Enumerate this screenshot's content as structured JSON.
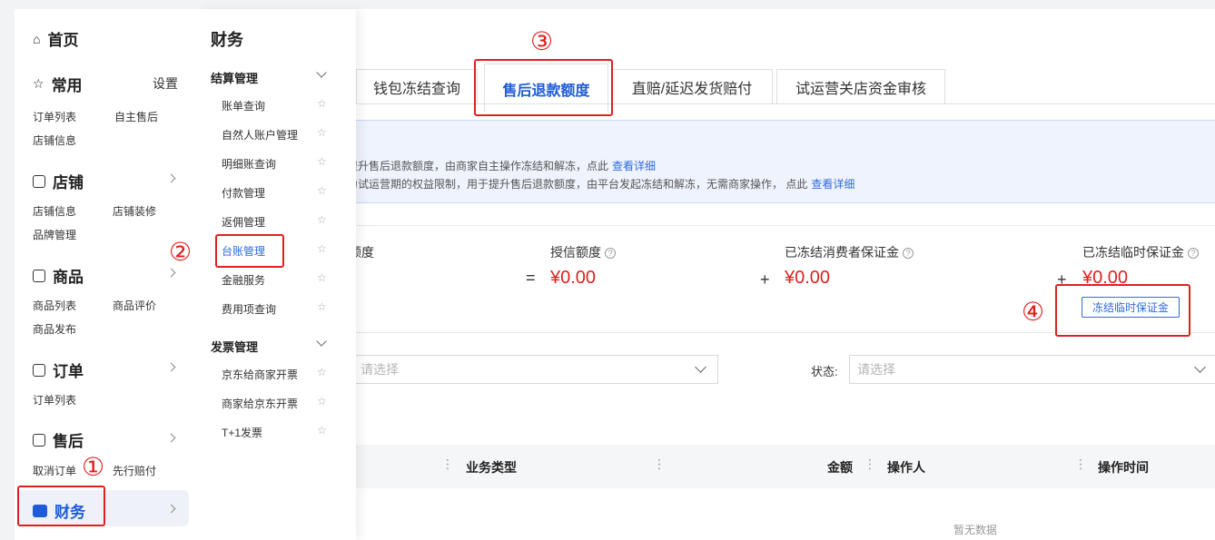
{
  "sidebar": {
    "home": "首页",
    "common": {
      "title": "常用",
      "settings": "设置",
      "links": [
        "订单列表",
        "自主售后",
        "店铺信息"
      ]
    },
    "store": {
      "title": "店铺",
      "links": [
        "店铺信息",
        "店铺装修",
        "品牌管理"
      ]
    },
    "goods": {
      "title": "商品",
      "links": [
        "商品列表",
        "商品评价",
        "商品发布"
      ]
    },
    "orders": {
      "title": "订单",
      "links": [
        "订单列表"
      ]
    },
    "aftersale": {
      "title": "售后",
      "links": [
        "取消订单",
        "先行赔付"
      ]
    },
    "finance": {
      "title": "财务"
    }
  },
  "submenu": {
    "title": "财务",
    "group1": "结算管理",
    "group1_items": [
      "账单查询",
      "自然人账户管理",
      "明细账查询",
      "付款管理",
      "返佣管理",
      "台账管理",
      "金融服务",
      "费用项查询"
    ],
    "group2": "发票管理",
    "group2_items": [
      "京东给商家开票",
      "商家给京东开票",
      "T+1发票"
    ]
  },
  "tabs": [
    "钱包冻结查询",
    "售后退款额度",
    "直赔/延迟发货赔付",
    "试运营关店资金审核"
  ],
  "notice": {
    "line1": "于提升售后退款额度，由商家自主操作冻结和解冻，点此",
    "line1_link": "查看详细",
    "line2": "金为试运营期的权益限制，用于提升售后退款额度，由平台发起冻结和解冻，无需商家操作， 点此",
    "line2_link": "查看详细"
  },
  "stats": {
    "label0": "额度",
    "op_eq": "=",
    "credit_label": "授信额度",
    "credit_value": "¥0.00",
    "op_plus1": "+",
    "consumer_label": "已冻结消费者保证金",
    "consumer_value": "¥0.00",
    "op_plus2": "+",
    "temp_label": "已冻结临时保证金",
    "temp_value": "¥0.00",
    "freeze_button": "冻结临时保证金"
  },
  "filters": {
    "select1_placeholder": "请选择",
    "status_label": "状态:",
    "select2_placeholder": "请选择"
  },
  "table": {
    "headers": [
      "业务类型",
      "金额",
      "操作人",
      "操作时间"
    ],
    "empty": "暂无数据"
  },
  "annotations": [
    "①",
    "②",
    "③",
    "④"
  ],
  "colors": {
    "accent": "#1e5bd8",
    "annotation_red": "#e02020",
    "amount_red": "#e02020"
  }
}
